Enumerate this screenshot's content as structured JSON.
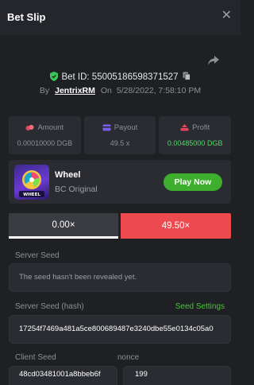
{
  "header": {
    "title": "Bet Slip",
    "close_icon": "close-icon"
  },
  "bet": {
    "id_label": "Bet ID: 55005186598371527",
    "by_label": "By",
    "user": "JentrixRM",
    "on_label": "On",
    "datetime": "5/28/2022, 7:58:10 PM"
  },
  "stats": {
    "amount": {
      "label": "Amount",
      "value": "0.00010000 DGB",
      "icon": "coins-icon"
    },
    "payout": {
      "label": "Payout",
      "value": "49.5 x",
      "icon": "card-icon"
    },
    "profit": {
      "label": "Profit",
      "value": "0.00485000 DGB",
      "icon": "profit-icon"
    }
  },
  "game": {
    "name": "Wheel",
    "provider": "BC Original",
    "play_label": "Play Now",
    "thumb_text": "WHEEL"
  },
  "result": {
    "left": "0.00×",
    "right": "49.50×"
  },
  "fairness": {
    "server_seed_label": "Server Seed",
    "server_seed_value": "The seed hasn't been revealed yet.",
    "server_hash_label": "Server Seed (hash)",
    "seed_settings_label": "Seed Settings",
    "server_hash_value": "17254f7469a481a5ce800689487e3240dbe55e0134c05a0",
    "client_seed_label": "Client Seed",
    "client_seed_value": "48cd03481001a8bbeb6f",
    "nonce_label": "nonce",
    "nonce_value": "199"
  },
  "colors": {
    "accent_green": "#3dae2d",
    "danger_red": "#ed4a4f",
    "background": "#1e2024",
    "panel": "#2a2c31"
  }
}
